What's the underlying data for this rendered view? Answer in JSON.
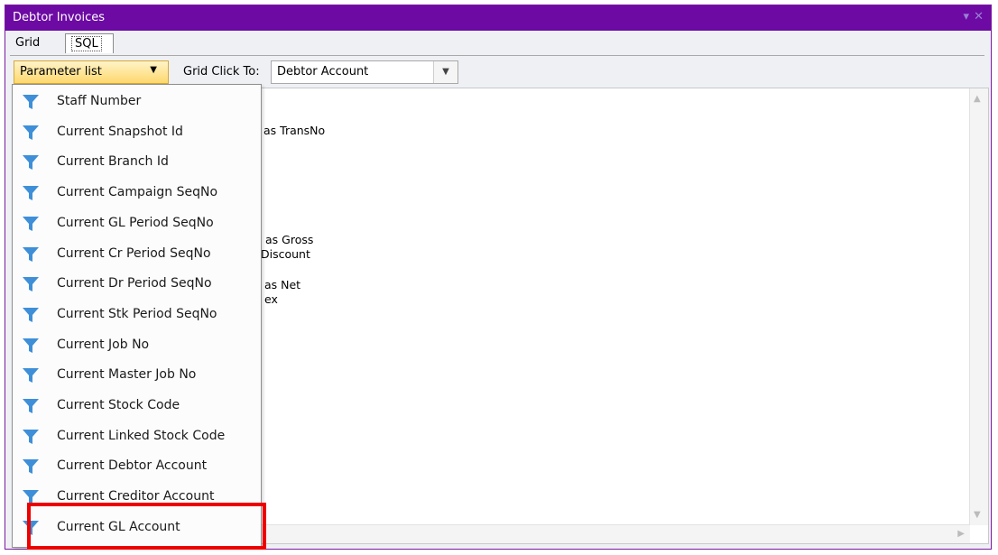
{
  "window": {
    "title": "Debtor Invoices",
    "pin_icon": "▾",
    "close_icon": "✕"
  },
  "tabs": [
    {
      "label": "Grid"
    },
    {
      "label": "SQL"
    }
  ],
  "toolbar": {
    "parameter_list_label": "Parameter list",
    "grid_click_label": "Grid Click To:",
    "grid_click_value": "Debtor Account"
  },
  "editor": {
    "visible_fragments": [
      "as TransNo",
      "as Gross",
      "Discount",
      "as Net",
      "ex"
    ]
  },
  "parameter_list": {
    "items": [
      "Staff Number",
      "Current Snapshot Id",
      "Current Branch Id",
      "Current Campaign SeqNo",
      "Current GL Period SeqNo",
      "Current Cr Period SeqNo",
      "Current Dr Period SeqNo",
      "Current Stk Period SeqNo",
      "Current Job No",
      "Current Master Job No",
      "Current Stock Code",
      "Current Linked Stock Code",
      "Current Debtor Account",
      "Current Creditor Account",
      "Current GL Account"
    ]
  },
  "highlight": {
    "item": "Current GL Account",
    "color": "#ee0000"
  },
  "colors": {
    "titlebar": "#6c0aa3",
    "accent_button": "#fdd86e",
    "filter_icon": "#3e8fd8"
  }
}
